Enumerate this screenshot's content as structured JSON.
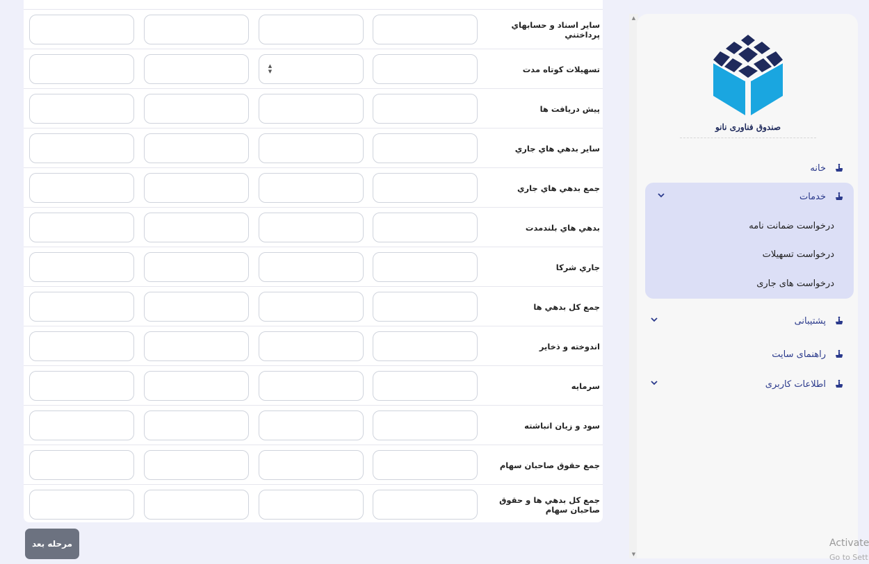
{
  "form": {
    "rows": [
      {
        "label": "ساير اسناد و حسابهاي پرداختني"
      },
      {
        "label": "تسهيلات کوتاه مدت"
      },
      {
        "label": "پيش دريافت ها"
      },
      {
        "label": "ساير بدهي هاي جاري"
      },
      {
        "label": "جمع بدهي هاي جاري"
      },
      {
        "label": "بدهي هاي بلندمدت"
      },
      {
        "label": "جاري شرکا"
      },
      {
        "label": "جمع کل بدهي ها"
      },
      {
        "label": "اندوخته و ذخاير"
      },
      {
        "label": "سرمايه"
      },
      {
        "label": "سود و زيان انباشته"
      },
      {
        "label": "جمع حقوق صاحبان سهام"
      },
      {
        "label": "جمع کل بدهي ها و حقوق صاحبان سهام"
      }
    ],
    "next_button": "مرحله بعد"
  },
  "sidebar": {
    "logo_text": "صندوق فناوری نانو",
    "nav": {
      "home": "خانه",
      "services": "خدمات",
      "services_sub": [
        "درخواست ضمانت نامه",
        "درخواست تسهيلات",
        "درخواست های جاری"
      ],
      "support": "پشتيبانی",
      "guide": "راهنمای سايت",
      "user_info": "اطلاعات کاربری"
    }
  },
  "overlay": {
    "activate": "Activate",
    "goto": "Go to Sett"
  },
  "colors": {
    "background": "#eff0fa",
    "logo_dark": "#1f2a5c",
    "logo_light": "#1aa6e0",
    "nav_text": "#2b3a8c",
    "services_bg": "#dcdff6",
    "button_bg": "#6c7280"
  },
  "icons": {
    "nav_item": "hand-icon",
    "expand": "chevron-down-icon",
    "scroll_up": "arrow-up-icon",
    "scroll_down": "arrow-down-icon",
    "number_spinner": "spinner-icon"
  }
}
